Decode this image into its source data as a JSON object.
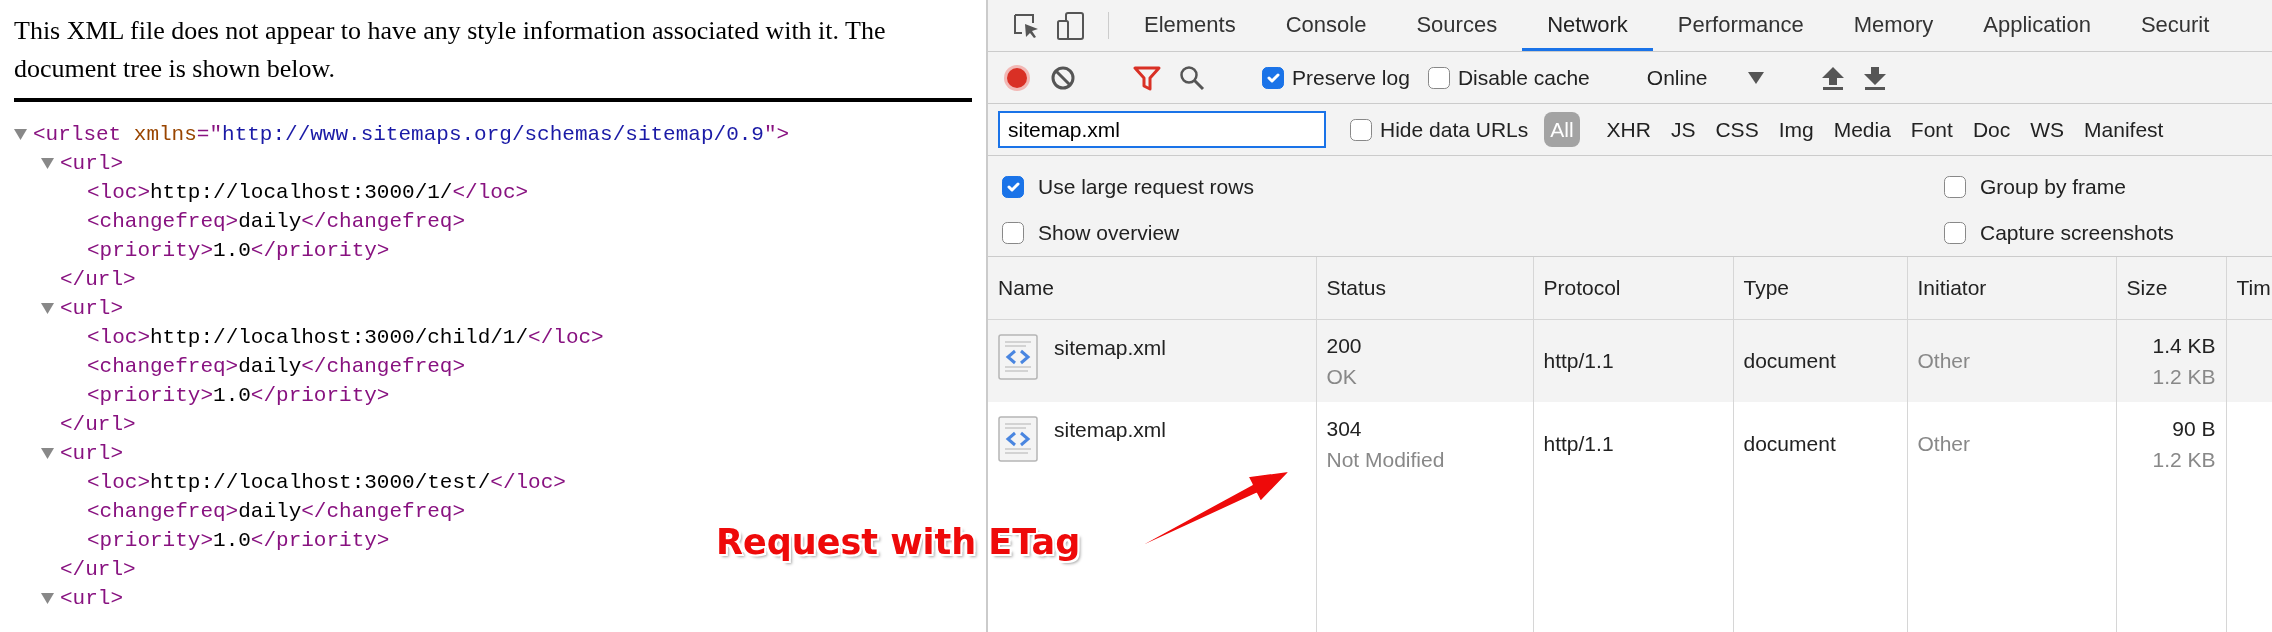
{
  "xml_viewer": {
    "notice": "This XML file does not appear to have any style information associated with it. The document tree is shown below.",
    "tree": [
      {
        "line": [
          {
            "kind": "tag",
            "text": "<urlset"
          },
          {
            "kind": "attr_name",
            "text": "xmlns"
          },
          {
            "kind": "tag",
            "text": "=\""
          },
          {
            "kind": "attr_value",
            "text": "http://www.sitemaps.org/schemas/sitemap/0.9"
          },
          {
            "kind": "tag",
            "text": "\">"
          }
        ],
        "expanded": true,
        "children": [
          {
            "line": [
              {
                "kind": "tag",
                "text": "<url>"
              }
            ],
            "expanded": true,
            "children": [
              {
                "line": [
                  {
                    "kind": "tag",
                    "text": "<loc>"
                  },
                  {
                    "kind": "text",
                    "text": "http://localhost:3000/1/"
                  },
                  {
                    "kind": "tag",
                    "text": "</loc>"
                  }
                ]
              },
              {
                "line": [
                  {
                    "kind": "tag",
                    "text": "<changefreq>"
                  },
                  {
                    "kind": "text",
                    "text": "daily"
                  },
                  {
                    "kind": "tag",
                    "text": "</changefreq>"
                  }
                ]
              },
              {
                "line": [
                  {
                    "kind": "tag",
                    "text": "<priority>"
                  },
                  {
                    "kind": "text",
                    "text": "1.0"
                  },
                  {
                    "kind": "tag",
                    "text": "</priority>"
                  }
                ]
              }
            ],
            "closing": [
              {
                "kind": "tag",
                "text": "</url>"
              }
            ]
          },
          {
            "line": [
              {
                "kind": "tag",
                "text": "<url>"
              }
            ],
            "expanded": true,
            "children": [
              {
                "line": [
                  {
                    "kind": "tag",
                    "text": "<loc>"
                  },
                  {
                    "kind": "text",
                    "text": "http://localhost:3000/child/1/"
                  },
                  {
                    "kind": "tag",
                    "text": "</loc>"
                  }
                ]
              },
              {
                "line": [
                  {
                    "kind": "tag",
                    "text": "<changefreq>"
                  },
                  {
                    "kind": "text",
                    "text": "daily"
                  },
                  {
                    "kind": "tag",
                    "text": "</changefreq>"
                  }
                ]
              },
              {
                "line": [
                  {
                    "kind": "tag",
                    "text": "<priority>"
                  },
                  {
                    "kind": "text",
                    "text": "1.0"
                  },
                  {
                    "kind": "tag",
                    "text": "</priority>"
                  }
                ]
              }
            ],
            "closing": [
              {
                "kind": "tag",
                "text": "</url>"
              }
            ]
          },
          {
            "line": [
              {
                "kind": "tag",
                "text": "<url>"
              }
            ],
            "expanded": true,
            "children": [
              {
                "line": [
                  {
                    "kind": "tag",
                    "text": "<loc>"
                  },
                  {
                    "kind": "text",
                    "text": "http://localhost:3000/test/"
                  },
                  {
                    "kind": "tag",
                    "text": "</loc>"
                  }
                ]
              },
              {
                "line": [
                  {
                    "kind": "tag",
                    "text": "<changefreq>"
                  },
                  {
                    "kind": "text",
                    "text": "daily"
                  },
                  {
                    "kind": "tag",
                    "text": "</changefreq>"
                  }
                ]
              },
              {
                "line": [
                  {
                    "kind": "tag",
                    "text": "<priority>"
                  },
                  {
                    "kind": "text",
                    "text": "1.0"
                  },
                  {
                    "kind": "tag",
                    "text": "</priority>"
                  }
                ]
              }
            ],
            "closing": [
              {
                "kind": "tag",
                "text": "</url>"
              }
            ]
          },
          {
            "line": [
              {
                "kind": "tag",
                "text": "<url>"
              }
            ],
            "expanded": true
          }
        ]
      }
    ]
  },
  "devtools": {
    "tabs": [
      {
        "label": "Elements",
        "selected": false
      },
      {
        "label": "Console",
        "selected": false
      },
      {
        "label": "Sources",
        "selected": false
      },
      {
        "label": "Network",
        "selected": true
      },
      {
        "label": "Performance",
        "selected": false
      },
      {
        "label": "Memory",
        "selected": false
      },
      {
        "label": "Application",
        "selected": false
      },
      {
        "label": "Securit",
        "selected": false
      }
    ],
    "toolbar": {
      "recording": true,
      "filter_active": true,
      "options": [
        {
          "label": "Preserve log",
          "checked": true
        },
        {
          "label": "Disable cache",
          "checked": false
        }
      ],
      "throttling": "Online"
    },
    "filter": {
      "value": "sitemap.xml",
      "hide_data_urls": {
        "label": "Hide data URLs",
        "checked": false
      },
      "types": [
        {
          "label": "All",
          "selected": true
        },
        {
          "label": "XHR",
          "selected": false
        },
        {
          "label": "JS",
          "selected": false
        },
        {
          "label": "CSS",
          "selected": false
        },
        {
          "label": "Img",
          "selected": false
        },
        {
          "label": "Media",
          "selected": false
        },
        {
          "label": "Font",
          "selected": false
        },
        {
          "label": "Doc",
          "selected": false
        },
        {
          "label": "WS",
          "selected": false
        },
        {
          "label": "Manifest",
          "selected": false
        }
      ]
    },
    "settings": [
      {
        "label": "Use large request rows",
        "checked": true
      },
      {
        "label": "Group by frame",
        "checked": false
      },
      {
        "label": "Show overview",
        "checked": false
      },
      {
        "label": "Capture screenshots",
        "checked": false
      }
    ],
    "table": {
      "columns": [
        "Name",
        "Status",
        "Protocol",
        "Type",
        "Initiator",
        "Size",
        "Tim"
      ],
      "rows": [
        {
          "name": "sitemap.xml",
          "status": "200",
          "status_text": "OK",
          "protocol": "http/1.1",
          "type": "document",
          "initiator": "Other",
          "size": "1.4 KB",
          "resource_size": "1.2 KB"
        },
        {
          "name": "sitemap.xml",
          "status": "304",
          "status_text": "Not Modified",
          "protocol": "http/1.1",
          "type": "document",
          "initiator": "Other",
          "size": "90 B",
          "resource_size": "1.2 KB"
        }
      ]
    }
  },
  "annotation": {
    "text": "Request with ETag"
  }
}
